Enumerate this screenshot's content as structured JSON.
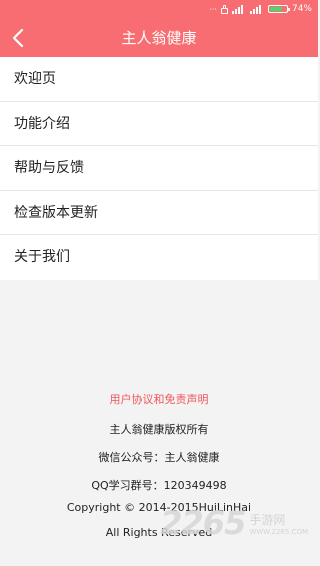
{
  "status_bar": {
    "battery_text": "74%",
    "battery_level": 0.74,
    "battery_color": "#3ee06b"
  },
  "header": {
    "title": "主人翁健康",
    "background": "#f76d71"
  },
  "menu": {
    "items": [
      {
        "label": "欢迎页"
      },
      {
        "label": "功能介绍"
      },
      {
        "label": "帮助与反馈"
      },
      {
        "label": "检查版本更新"
      },
      {
        "label": "关于我们"
      }
    ]
  },
  "footer": {
    "agreement_link": "用户协议和免责声明",
    "copyright_owner": "主人翁健康版权所有",
    "wechat": "微信公众号：主人翁健康",
    "qq_group": "QQ学习群号：120349498",
    "copyright": "Copyright © 2014-2015HuiLinHai",
    "rights": "All Rights Reserved",
    "link_color": "#f0565c"
  },
  "watermark": {
    "number": "2265",
    "name": "手游网",
    "url": "WWW.2265.COM"
  }
}
